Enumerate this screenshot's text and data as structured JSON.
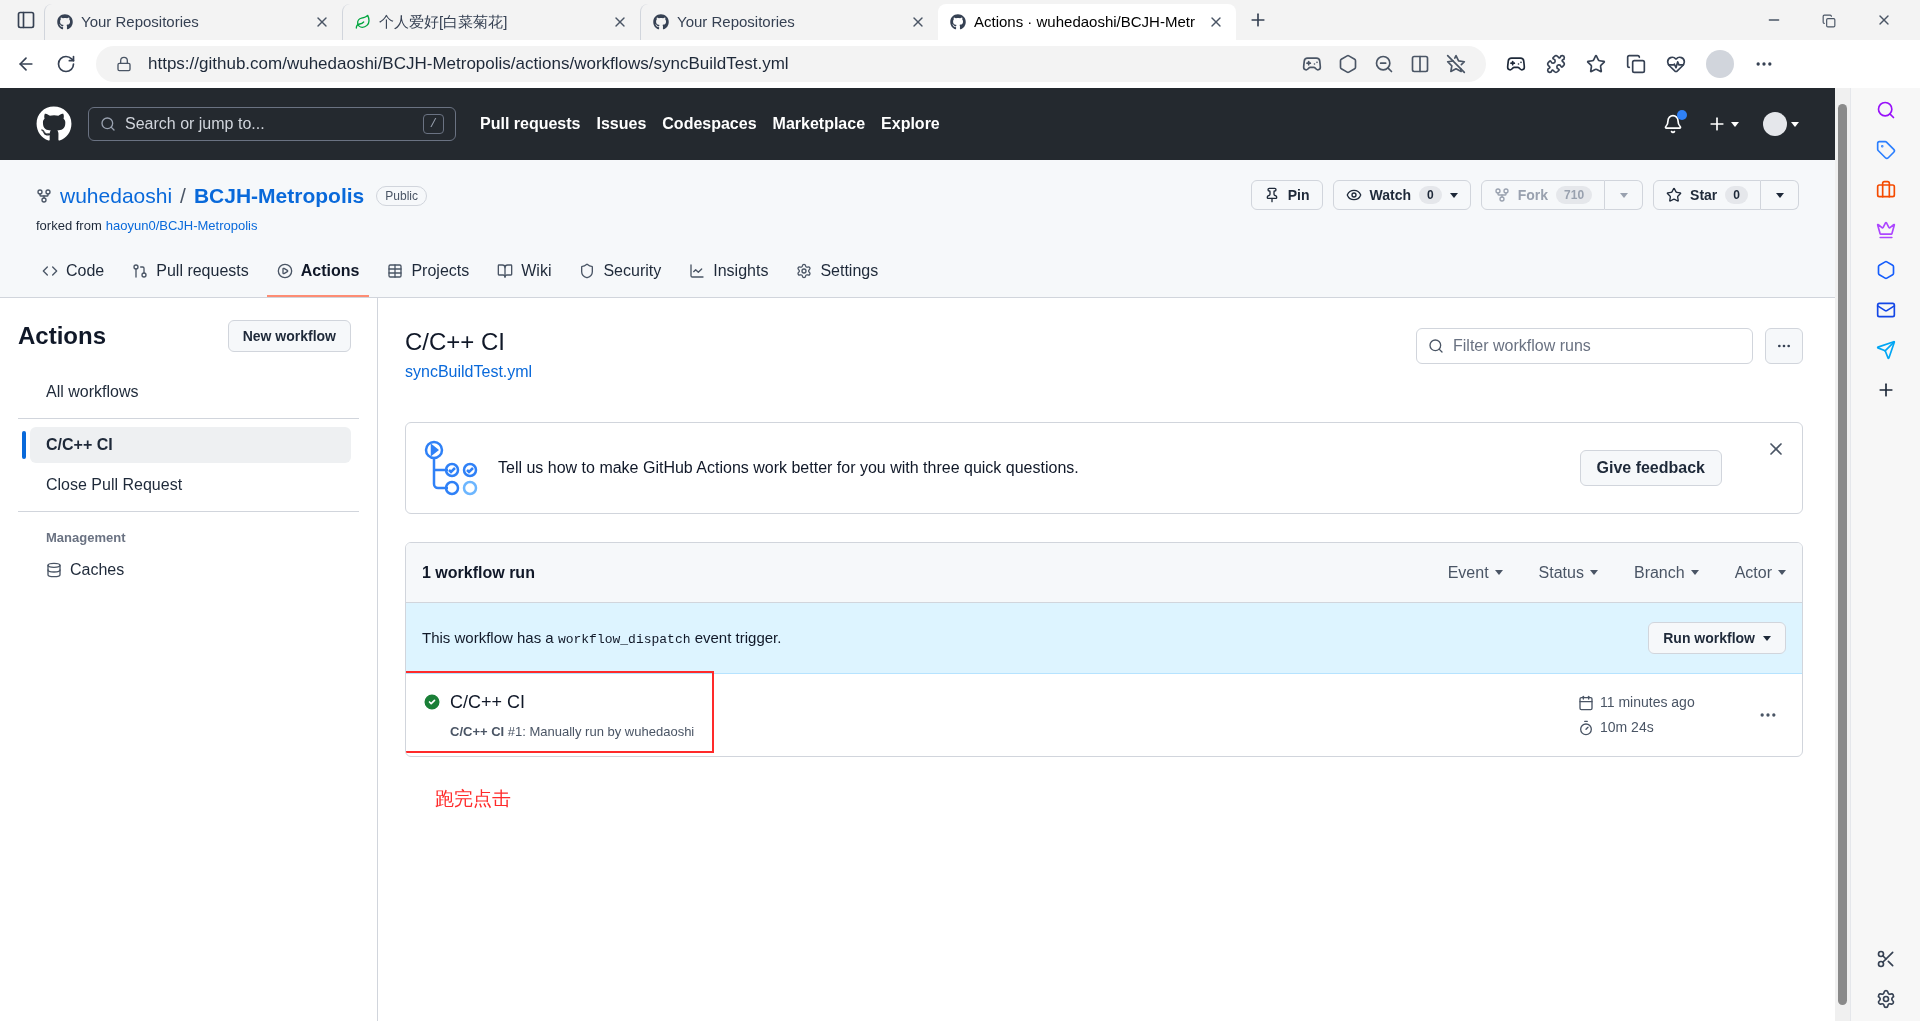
{
  "browser": {
    "tabs": [
      {
        "title": "Your Repositories",
        "kind": "github",
        "selected": false
      },
      {
        "title": "个人爱好[白菜菊花]",
        "kind": "leaf",
        "selected": false
      },
      {
        "title": "Your Repositories",
        "kind": "github",
        "selected": false
      },
      {
        "title": "Actions · wuhedaoshi/BCJH-Metr",
        "kind": "github",
        "selected": true
      }
    ],
    "url": "https://github.com/wuhedaoshi/BCJH-Metropolis/actions/workflows/syncBuildTest.yml"
  },
  "header": {
    "search": {
      "placeholder": "Search or jump to...",
      "shortcut": "/"
    },
    "nav": [
      "Pull requests",
      "Issues",
      "Codespaces",
      "Marketplace",
      "Explore"
    ],
    "notification_unread": true
  },
  "repo": {
    "owner": "wuhedaoshi",
    "separator": "/",
    "name": "BCJH-Metropolis",
    "visibility": "Public",
    "forked_prefix": "forked from",
    "forked_from": "haoyun0/BCJH-Metropolis",
    "actions": [
      {
        "kind": "pin",
        "label": "Pin",
        "disabled": false
      },
      {
        "kind": "watch",
        "label": "Watch",
        "count": "0",
        "disabled": false
      },
      {
        "kind": "fork",
        "label": "Fork",
        "count": "710",
        "disabled": true
      },
      {
        "kind": "star",
        "label": "Star",
        "count": "0",
        "disabled": false
      }
    ],
    "tabs": [
      {
        "kind": "code",
        "label": "Code",
        "selected": false
      },
      {
        "kind": "pulls",
        "label": "Pull requests",
        "selected": false
      },
      {
        "kind": "actions",
        "label": "Actions",
        "selected": true
      },
      {
        "kind": "projects",
        "label": "Projects",
        "selected": false
      },
      {
        "kind": "wiki",
        "label": "Wiki",
        "selected": false
      },
      {
        "kind": "security",
        "label": "Security",
        "selected": false
      },
      {
        "kind": "insights",
        "label": "Insights",
        "selected": false
      },
      {
        "kind": "settings",
        "label": "Settings",
        "selected": false
      }
    ]
  },
  "sidebar": {
    "title": "Actions",
    "new_button": "New workflow",
    "all": {
      "label": "All workflows",
      "selected": false
    },
    "workflows": [
      {
        "label": "C/C++ CI",
        "selected": true
      },
      {
        "label": "Close Pull Request",
        "selected": false
      }
    ],
    "section": "Management",
    "management": [
      {
        "label": "Caches",
        "selected": false
      }
    ]
  },
  "main": {
    "title": "C/C++ CI",
    "file": "syncBuildTest.yml",
    "filter": {
      "placeholder": "Filter workflow runs"
    },
    "feedback": {
      "message": "Tell us how to make GitHub Actions work better for you with three quick questions.",
      "button": "Give feedback"
    },
    "runs": {
      "count": "1 workflow run",
      "filters": [
        "Event",
        "Status",
        "Branch",
        "Actor"
      ],
      "dispatch": {
        "prefix": "This workflow has a ",
        "code": "workflow_dispatch",
        "suffix": " event trigger.",
        "button": "Run workflow"
      },
      "items": [
        {
          "kind": "success",
          "title": "C/C++ CI",
          "subtitle": "**C/C++ CI** #1: Manually run by wuhedaoshi",
          "time": "11 minutes ago",
          "duration": "10m 24s",
          "highlighted": true
        }
      ]
    }
  },
  "annotation": {
    "note": "跑完点击"
  }
}
